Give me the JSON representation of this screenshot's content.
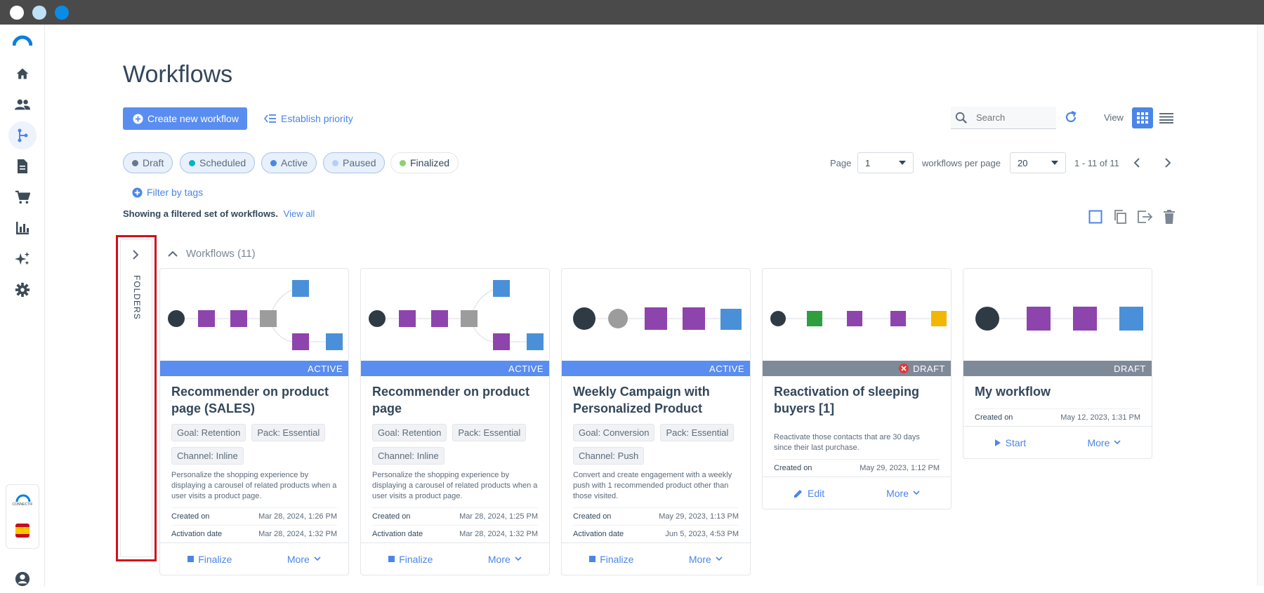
{
  "window": {
    "dots": [
      "#ffffff",
      "#bfe1f7",
      "#0a8be6"
    ]
  },
  "sidebar": {
    "items": [
      {
        "icon": "home-icon"
      },
      {
        "icon": "contacts-icon"
      },
      {
        "icon": "workflow-icon"
      },
      {
        "icon": "document-icon"
      },
      {
        "icon": "cart-icon"
      },
      {
        "icon": "chart-icon"
      },
      {
        "icon": "sparkle-icon"
      },
      {
        "icon": "gear-icon"
      }
    ],
    "brand_small": "CONNECTIF"
  },
  "header": {
    "title": "Workflows",
    "create_label": "Create new workflow",
    "priority_label": "Establish priority",
    "search_placeholder": "Search",
    "view_label": "View"
  },
  "filters": {
    "chips": [
      {
        "label": "Draft",
        "color": "#66788a"
      },
      {
        "label": "Scheduled",
        "color": "#00b3c9"
      },
      {
        "label": "Active",
        "color": "#4a86e8"
      },
      {
        "label": "Paused",
        "color": "#b6cff7"
      },
      {
        "label": "Finalized",
        "color": "#8fcf72"
      }
    ],
    "filter_by_tags": "Filter by tags"
  },
  "pager": {
    "page_label": "Page",
    "page_value": "1",
    "per_page_label": "workflows per page",
    "per_page_value": "20",
    "range": "1 - 11 of 11"
  },
  "notice": {
    "text": "Showing a filtered set of workflows.",
    "link": "View all"
  },
  "folders": {
    "label": "FOLDERS"
  },
  "group": {
    "label": "Workflows (11)"
  },
  "labels": {
    "created_on": "Created on",
    "activation_date": "Activation date",
    "finalize": "Finalize",
    "more": "More",
    "edit": "Edit",
    "start": "Start"
  },
  "cards": [
    {
      "status": "ACTIVE",
      "title": "Recommender on product page (SALES)",
      "tags": [
        "Goal: Retention",
        "Pack: Essential",
        "Channel: Inline"
      ],
      "description": "Personalize the shopping experience by displaying a carousel of related products when a user visits a product page.",
      "created_on": "Mar 28, 2024, 1:26 PM",
      "activation_date": "Mar 28, 2024, 1:32 PM"
    },
    {
      "status": "ACTIVE",
      "title": "Recommender on product page",
      "tags": [
        "Goal: Retention",
        "Pack: Essential",
        "Channel: Inline"
      ],
      "description": "Personalize the shopping experience by displaying a carousel of related products when a user visits a product page.",
      "created_on": "Mar 28, 2024, 1:25 PM",
      "activation_date": "Mar 28, 2024, 1:32 PM"
    },
    {
      "status": "ACTIVE",
      "title": "Weekly Campaign with Personalized Product",
      "tags": [
        "Goal: Conversion",
        "Pack: Essential",
        "Channel: Push"
      ],
      "description": "Convert and create engagement with a weekly push with 1 recommended product other than those visited.",
      "created_on": "May 29, 2023, 1:13 PM",
      "activation_date": "Jun 5, 2023, 4:53 PM"
    },
    {
      "status": "DRAFT",
      "title": "Reactivation of sleeping buyers [1]",
      "description": "Reactivate those contacts that are 30 days since their last purchase.",
      "created_on": "May 29, 2023, 1:12 PM"
    },
    {
      "status": "DRAFT",
      "title": "My workflow",
      "created_on": "May 12, 2023, 1:31 PM"
    }
  ]
}
